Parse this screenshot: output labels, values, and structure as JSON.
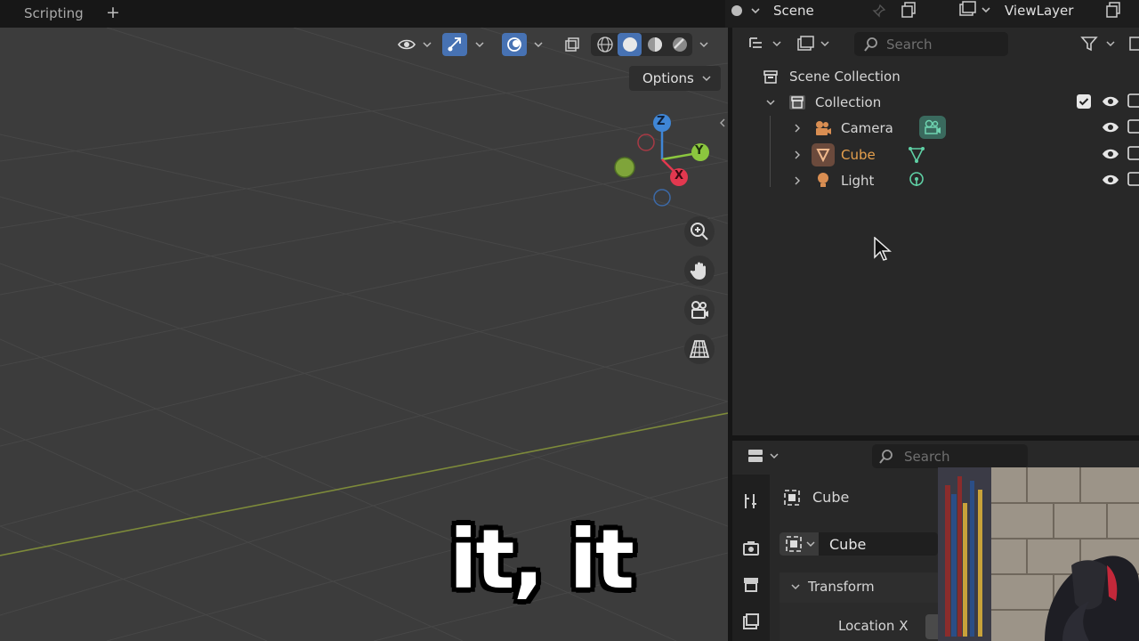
{
  "workspace_tab": {
    "label": "Scripting",
    "add_label": "+"
  },
  "scene": {
    "label": "Scene"
  },
  "view_layer": {
    "label": "ViewLayer"
  },
  "viewport": {
    "options_label": "Options",
    "gizmo": {
      "x": "X",
      "y": "Y",
      "z": "Z"
    }
  },
  "outliner": {
    "search_placeholder": "Search",
    "root": "Scene Collection",
    "collection": "Collection",
    "items": [
      {
        "label": "Camera",
        "icon": "camera-icon",
        "color": "#d6d6d6"
      },
      {
        "label": "Cube",
        "icon": "mesh-icon",
        "color": "#e6a04d"
      },
      {
        "label": "Light",
        "icon": "light-icon",
        "color": "#d6d6d6"
      }
    ]
  },
  "properties": {
    "search_placeholder": "Search",
    "object_name": "Cube",
    "datablock": "Cube",
    "panel": "Transform",
    "field": "Location X"
  },
  "caption": {
    "text": "it, it"
  },
  "colors": {
    "accent": "#4772b3",
    "x_axis": "#e2384f",
    "y_axis": "#8bc63e",
    "z_axis": "#3f86d6",
    "selected": "#e6a04d"
  }
}
